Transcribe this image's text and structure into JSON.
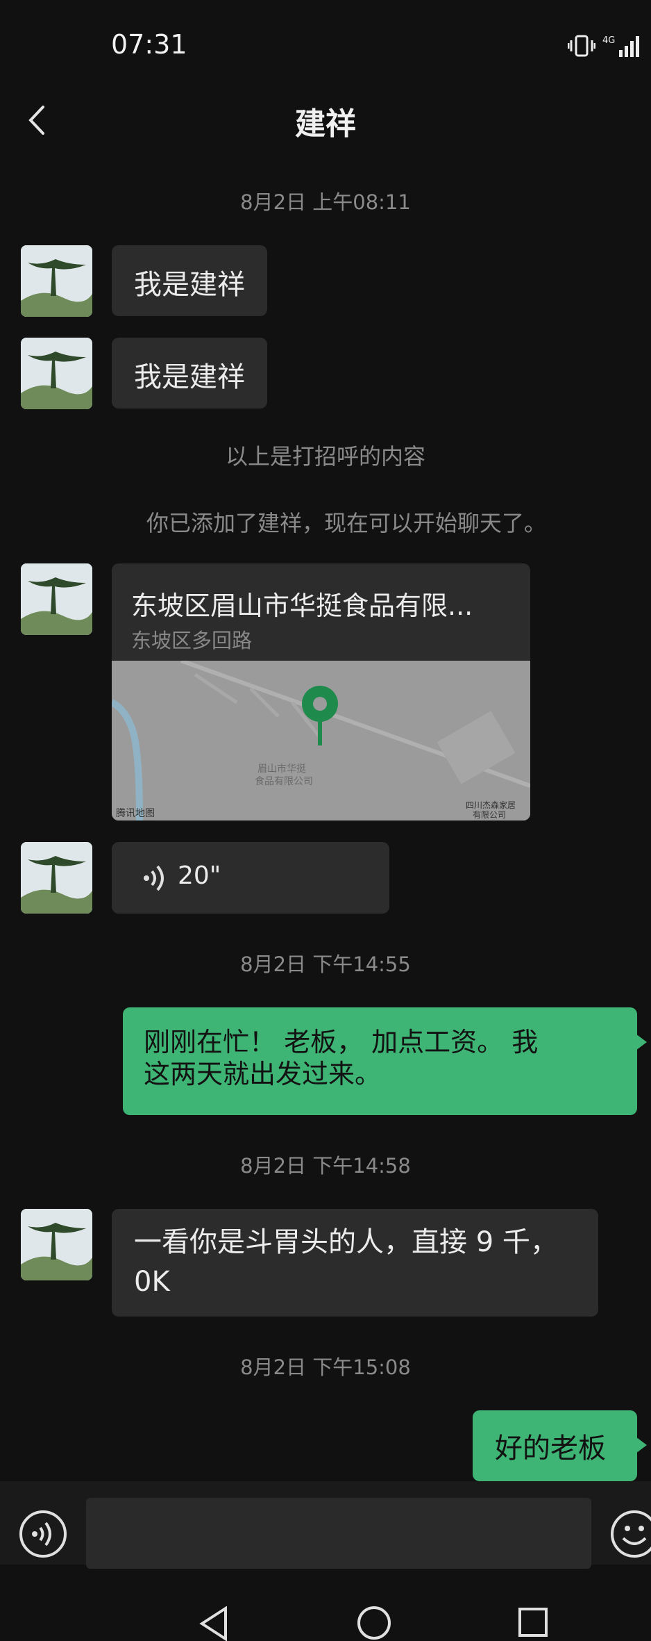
{
  "status": {
    "time": "07:31"
  },
  "header": {
    "title": "建祥"
  },
  "timestamps": [
    "8月2日 上午08:11",
    "8月2日 下午14:55",
    "8月2日 下午14:58",
    "8月2日 下午15:08"
  ],
  "system": {
    "greeting_note": "以上是打招呼的内容",
    "added_note": "你已添加了建祥，现在可以开始聊天了。"
  },
  "messages": {
    "m1": "我是建祥",
    "m2": "我是建祥",
    "location": {
      "title": "东坡区眉山市华挺食品有限...",
      "address": "东坡区多回路",
      "map_label": "眉山市华挺\n食品有限公司",
      "map_label2": "四川杰森家居\n有限公司",
      "map_brand": "腾讯地图"
    },
    "voice": "20\"",
    "m3_line1": "刚刚在忙！  老板，  加点工资。  我",
    "m3_line2": "这两天就出发过来。",
    "m4_line1": "一看你是斗胃头的人，直接 9 千，",
    "m4_line2": "0K",
    "m5": "好的老板"
  },
  "colors": {
    "accent": "#3eb575",
    "bubble": "#2c2c2c",
    "bg": "#111111"
  }
}
